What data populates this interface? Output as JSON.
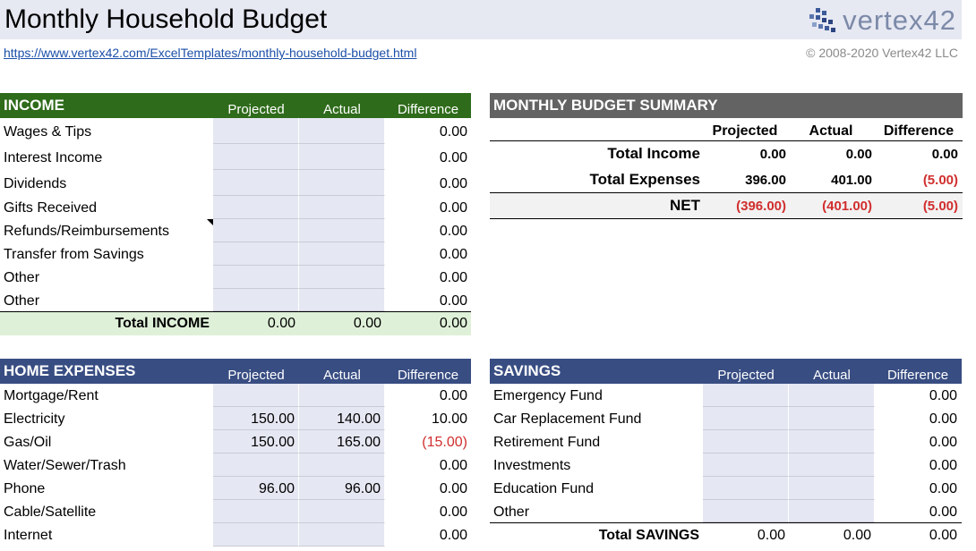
{
  "header": {
    "title": "Monthly Household Budget",
    "logo_text": "vertex42",
    "link": "https://www.vertex42.com/ExcelTemplates/monthly-household-budget.html",
    "copyright": "© 2008-2020 Vertex42 LLC"
  },
  "columns": {
    "projected": "Projected",
    "actual": "Actual",
    "difference": "Difference"
  },
  "income": {
    "title": "INCOME",
    "rows": [
      {
        "label": "Wages & Tips",
        "projected": "",
        "actual": "",
        "difference": "0.00"
      },
      {
        "label": "Interest Income",
        "projected": "",
        "actual": "",
        "difference": "0.00"
      },
      {
        "label": "Dividends",
        "projected": "",
        "actual": "",
        "difference": "0.00"
      },
      {
        "label": "Gifts Received",
        "projected": "",
        "actual": "",
        "difference": "0.00"
      },
      {
        "label": "Refunds/Reimbursements",
        "projected": "",
        "actual": "",
        "difference": "0.00"
      },
      {
        "label": "Transfer from Savings",
        "projected": "",
        "actual": "",
        "difference": "0.00"
      },
      {
        "label": "Other",
        "projected": "",
        "actual": "",
        "difference": "0.00"
      },
      {
        "label": "Other",
        "projected": "",
        "actual": "",
        "difference": "0.00"
      }
    ],
    "total": {
      "label": "Total INCOME",
      "projected": "0.00",
      "actual": "0.00",
      "difference": "0.00"
    }
  },
  "summary": {
    "title": "MONTHLY BUDGET SUMMARY",
    "rows": [
      {
        "label": "Total Income",
        "projected": "0.00",
        "actual": "0.00",
        "difference": "0.00"
      },
      {
        "label": "Total Expenses",
        "projected": "396.00",
        "actual": "401.00",
        "difference": "(5.00)"
      },
      {
        "label": "NET",
        "projected": "(396.00)",
        "actual": "(401.00)",
        "difference": "(5.00)"
      }
    ]
  },
  "home_expenses": {
    "title": "HOME EXPENSES",
    "rows": [
      {
        "label": "Mortgage/Rent",
        "projected": "",
        "actual": "",
        "difference": "0.00"
      },
      {
        "label": "Electricity",
        "projected": "150.00",
        "actual": "140.00",
        "difference": "10.00"
      },
      {
        "label": "Gas/Oil",
        "projected": "150.00",
        "actual": "165.00",
        "difference": "(15.00)"
      },
      {
        "label": "Water/Sewer/Trash",
        "projected": "",
        "actual": "",
        "difference": "0.00"
      },
      {
        "label": "Phone",
        "projected": "96.00",
        "actual": "96.00",
        "difference": "0.00"
      },
      {
        "label": "Cable/Satellite",
        "projected": "",
        "actual": "",
        "difference": "0.00"
      },
      {
        "label": "Internet",
        "projected": "",
        "actual": "",
        "difference": "0.00"
      }
    ]
  },
  "savings": {
    "title": "SAVINGS",
    "rows": [
      {
        "label": "Emergency Fund",
        "projected": "",
        "actual": "",
        "difference": "0.00"
      },
      {
        "label": "Car Replacement Fund",
        "projected": "",
        "actual": "",
        "difference": "0.00"
      },
      {
        "label": "Retirement Fund",
        "projected": "",
        "actual": "",
        "difference": "0.00"
      },
      {
        "label": "Investments",
        "projected": "",
        "actual": "",
        "difference": "0.00"
      },
      {
        "label": "Education Fund",
        "projected": "",
        "actual": "",
        "difference": "0.00"
      },
      {
        "label": "Other",
        "projected": "",
        "actual": "",
        "difference": "0.00"
      }
    ],
    "total": {
      "label": "Total SAVINGS",
      "projected": "0.00",
      "actual": "0.00",
      "difference": "0.00"
    }
  },
  "colors": {
    "income_header": "#2e6b1a",
    "blue_header": "#384d82",
    "summary_header": "#636363",
    "input_cell": "#e5e7f2",
    "total_fill": "#dff0d8",
    "negative": "#d12e2e"
  }
}
